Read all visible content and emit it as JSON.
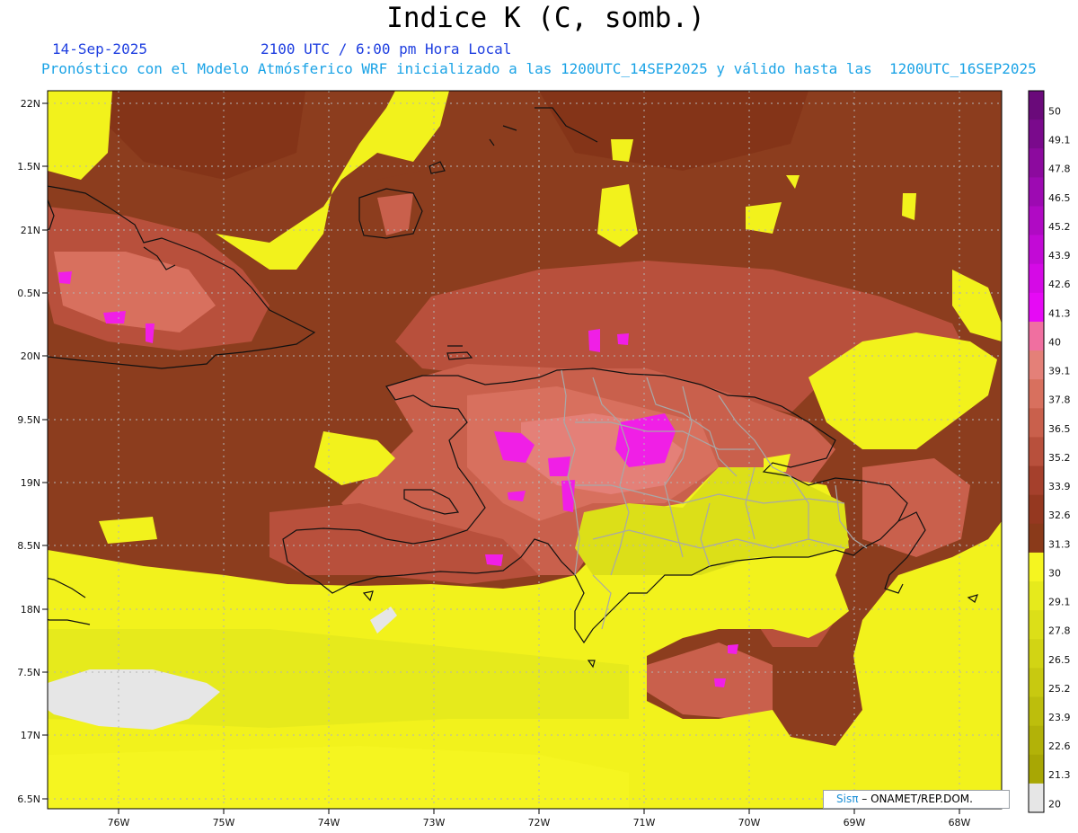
{
  "title": "Indice K (C, somb.)",
  "header": {
    "date": "14-Sep-2025",
    "time": "2100 UTC / 6:00 pm Hora Local",
    "info": "Pronóstico con el Modelo Atmósferico WRF inicializado a las 1200UTC_14SEP2025 y válido hasta las  1200UTC_16SEP2025"
  },
  "map": {
    "lat_ticks": [
      "22N",
      "1.5N",
      "21N",
      "0.5N",
      "20N",
      "9.5N",
      "19N",
      "8.5N",
      "18N",
      "7.5N",
      "17N",
      "6.5N"
    ],
    "lon_ticks": [
      "76W",
      "75W",
      "74W",
      "73W",
      "72W",
      "71W",
      "70W",
      "69W",
      "68W"
    ],
    "lat_range": [
      16.5,
      22
    ],
    "lon_range": [
      -76.65,
      -67.4
    ],
    "grid": true,
    "field": "K index (C), shaded"
  },
  "colorbar": {
    "values": [
      "50",
      "49.1",
      "47.8",
      "46.5",
      "45.2",
      "43.9",
      "42.6",
      "41.3",
      "40",
      "39.1",
      "37.8",
      "36.5",
      "35.2",
      "33.9",
      "32.6",
      "31.3",
      "30",
      "29.1",
      "27.8",
      "26.5",
      "25.2",
      "23.9",
      "22.6",
      "21.3",
      "20"
    ],
    "colors": [
      "#6a0a7a",
      "#7a0a8c",
      "#8c0a9e",
      "#9d0ab2",
      "#b00ac4",
      "#c20ad6",
      "#d50ae6",
      "#e60af5",
      "#f06fa0",
      "#e48078",
      "#d8705e",
      "#c9604c",
      "#b8503c",
      "#a5402c",
      "#953820",
      "#8a3a1a",
      "#f5f520",
      "#e6ea1c",
      "#dcdf18",
      "#d2d414",
      "#c8c910",
      "#bdbe0c",
      "#b2b208",
      "#a8a704",
      "#e6e6e6"
    ]
  },
  "colors": {
    "yellow": "#f2f21c",
    "brown": "#8c3d1e",
    "salmon": "#c8604c",
    "pink": "#e07a70",
    "magenta": "#f01fe6",
    "gray": "#e6e6e6"
  },
  "credit": {
    "brand": "Sisπ",
    "text": " – ONAMET/REP.DOM."
  }
}
